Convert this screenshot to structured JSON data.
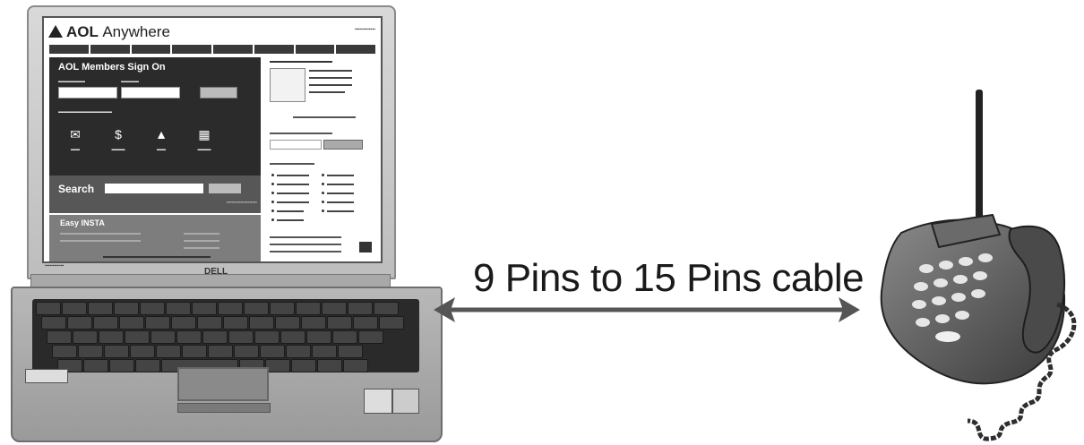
{
  "caption": "9 Pins to 15 Pins cable",
  "laptop": {
    "brand": "DELL",
    "screen": {
      "logo_bold": "AOL",
      "logo_rest": "Anywhere",
      "signon_title": "AOL Members Sign On",
      "search_label": "Search",
      "easy_title": "Easy INSTA"
    }
  },
  "colors": {
    "line": "#555555",
    "text": "#1a1a1a"
  },
  "icons": [
    "aol-triangle-logo-icon",
    "antenna-icon",
    "double-arrow-icon"
  ]
}
